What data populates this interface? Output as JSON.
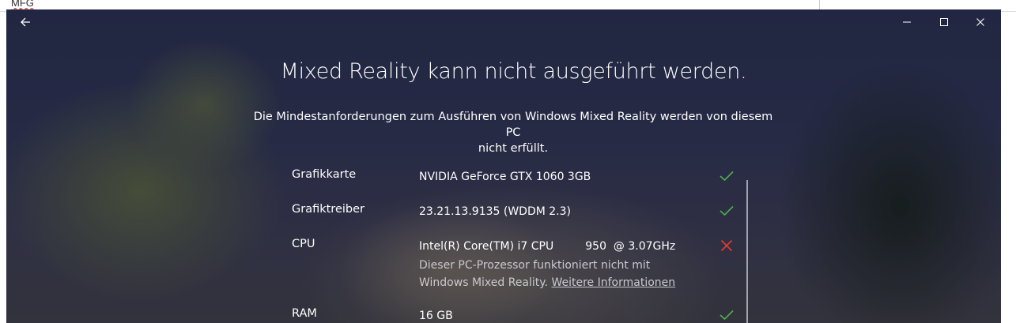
{
  "background_app": {
    "text": "MFG"
  },
  "window": {
    "back_icon": "arrow-left-icon",
    "controls": [
      "minimize-icon",
      "maximize-icon",
      "close-icon"
    ]
  },
  "main": {
    "title": "Mixed Reality kann nicht ausgeführt werden.",
    "subtitle_line1": "Die Mindestanforderungen zum Ausführen von Windows Mixed Reality werden von diesem PC",
    "subtitle_line2": "nicht erfüllt."
  },
  "requirements": [
    {
      "label": "Grafikkarte",
      "value": "NVIDIA GeForce GTX 1060 3GB",
      "status": "ok"
    },
    {
      "label": "Grafiktreiber",
      "value": "23.21.13.9135 (WDDM 2.3)",
      "status": "ok"
    },
    {
      "label": "CPU",
      "value": "Intel(R) Core(TM) i7 CPU         950  @ 3.07GHz",
      "status": "fail",
      "note": "Dieser PC-Prozessor funktioniert nicht mit Windows Mixed Reality.",
      "link": "Weitere Informationen"
    },
    {
      "label": "RAM",
      "value": "16 GB",
      "status": "ok"
    }
  ],
  "colors": {
    "ok": "#4caf50",
    "fail": "#e53935",
    "note_text": "#c9c9cf"
  }
}
